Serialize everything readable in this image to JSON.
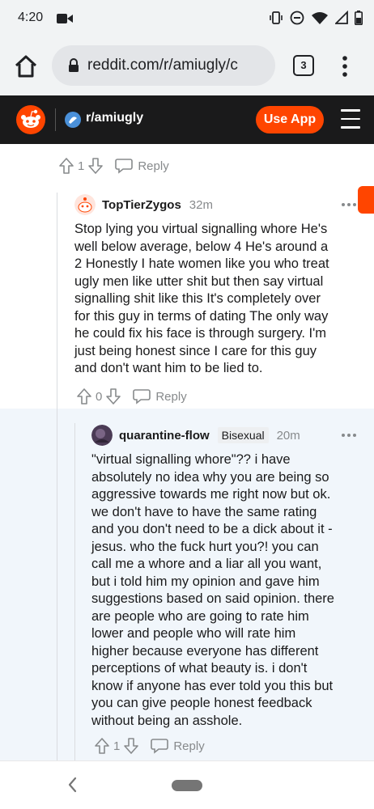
{
  "status_bar": {
    "time": "4:20"
  },
  "browser": {
    "url": "reddit.com/r/amiugly/c",
    "tab_count": "3"
  },
  "reddit_header": {
    "subreddit": "r/amiugly",
    "use_app_label": "Use App",
    "accent_color": "#ff4500"
  },
  "thread": {
    "parent_actions": {
      "score": "1",
      "reply_label": "Reply"
    },
    "comments": [
      {
        "username": "TopTierZygos",
        "flair": "",
        "age": "32m",
        "lines": [
          "Stop lying you virtual signalling whore He's",
          "well below average, below 4 He's around a",
          "2 Honestly I hate women like you who treat",
          "ugly men like utter shit but then say virtual",
          "signalling shit like this It's completely over",
          "for this guy in terms of dating The only way",
          "he could fix his face is through surgery. I'm",
          "just being honest since I care for this guy",
          "and don't want him to be lied to."
        ],
        "score": "0",
        "reply_label": "Reply"
      },
      {
        "username": "quarantine-flow",
        "flair": "Bisexual",
        "age": "20m",
        "lines": [
          "\"virtual signalling whore\"?? i have",
          "absolutely no idea why you are being so",
          "aggressive towards me right now but ok.",
          "we don't have to have the same rating",
          "and you don't need to be a dick about it -",
          "jesus. who the fuck hurt you?! you can",
          "call me a whore and a liar all you want,",
          "but i told him my opinion and gave him",
          "suggestions based on said opinion. there",
          "are people who are going to rate him",
          "lower and people who will rate him",
          "higher because everyone has different",
          "perceptions of what beauty is. i don't",
          "know if anyone has ever told you this but",
          "you can give people honest feedback",
          "without being an asshole."
        ],
        "score": "1",
        "reply_label": "Reply"
      }
    ]
  }
}
